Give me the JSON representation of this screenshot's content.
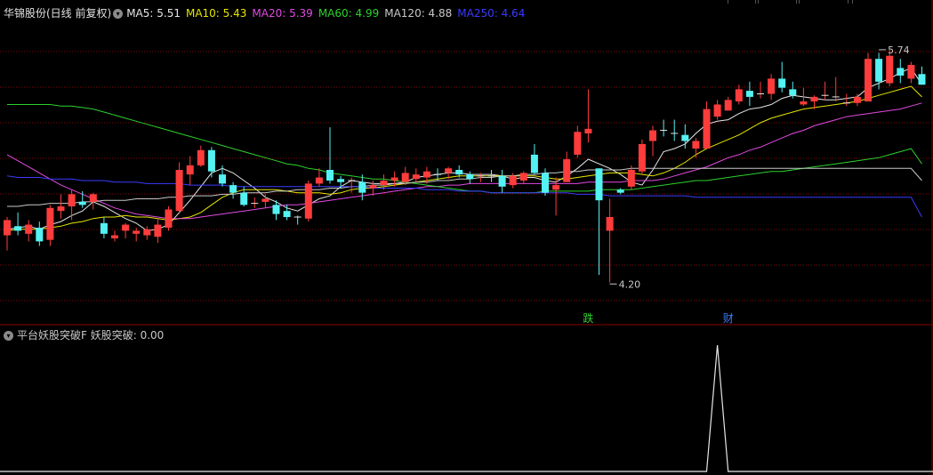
{
  "header": {
    "stock_label": "华锦股份(日线 前复权)",
    "ma": [
      {
        "label": "MA5: 5.51",
        "color": "#e6e6e6"
      },
      {
        "label": "MA10: 5.43",
        "color": "#e6e600"
      },
      {
        "label": "MA20: 5.39",
        "color": "#e24ae2"
      },
      {
        "label": "MA60: 4.99",
        "color": "#2dd12d"
      },
      {
        "label": "MA120: 4.88",
        "color": "#c8c8c8"
      },
      {
        "label": "MA250: 4.64",
        "color": "#3a3aff"
      }
    ]
  },
  "indicator": {
    "name": "平台妖股突破F",
    "value_label": "妖股突破: 0.00"
  },
  "colors": {
    "up": "#ff3c3c",
    "down": "#54f2f2",
    "grid": "#8b0000",
    "divider": "#8b0000"
  },
  "chart_data": [
    {
      "type": "candlestick",
      "title": "华锦股份(日线 前复权)",
      "ylim": [
        3.95,
        5.95
      ],
      "grid": true,
      "annotations": [
        {
          "text": "5.74",
          "candle": 81,
          "price": 5.74
        },
        {
          "text": "4.20",
          "candle": 56,
          "price": 4.2
        },
        {
          "text": "跌",
          "candle": 54,
          "color": "#2dd12d"
        },
        {
          "text": "财",
          "candle": 67,
          "color": "#3a7cff"
        }
      ],
      "candles": [
        [
          4.52,
          4.64,
          4.42,
          4.62
        ],
        [
          4.58,
          4.67,
          4.52,
          4.55
        ],
        [
          4.53,
          4.62,
          4.48,
          4.59
        ],
        [
          4.57,
          4.61,
          4.45,
          4.48
        ],
        [
          4.49,
          4.72,
          4.45,
          4.7
        ],
        [
          4.68,
          4.79,
          4.63,
          4.71
        ],
        [
          4.71,
          4.82,
          4.62,
          4.79
        ],
        [
          4.74,
          4.81,
          4.7,
          4.72
        ],
        [
          4.74,
          4.8,
          4.69,
          4.79
        ],
        [
          4.6,
          4.64,
          4.5,
          4.53
        ],
        [
          4.5,
          4.55,
          4.48,
          4.52
        ],
        [
          4.55,
          4.6,
          4.5,
          4.59
        ],
        [
          4.53,
          4.57,
          4.48,
          4.55
        ],
        [
          4.52,
          4.58,
          4.49,
          4.56
        ],
        [
          4.51,
          4.63,
          4.47,
          4.59
        ],
        [
          4.57,
          4.71,
          4.55,
          4.69
        ],
        [
          4.68,
          5.0,
          4.66,
          4.95
        ],
        [
          4.92,
          5.04,
          4.85,
          4.98
        ],
        [
          4.98,
          5.11,
          4.97,
          5.08
        ],
        [
          5.08,
          5.1,
          4.9,
          4.94
        ],
        [
          4.92,
          4.98,
          4.84,
          4.86
        ],
        [
          4.85,
          4.87,
          4.76,
          4.8
        ],
        [
          4.8,
          4.84,
          4.71,
          4.72
        ],
        [
          4.73,
          4.77,
          4.7,
          4.73
        ],
        [
          4.74,
          4.79,
          4.7,
          4.76
        ],
        [
          4.72,
          4.75,
          4.62,
          4.66
        ],
        [
          4.68,
          4.72,
          4.62,
          4.64
        ],
        [
          4.64,
          4.65,
          4.59,
          4.63
        ],
        [
          4.63,
          4.88,
          4.61,
          4.86
        ],
        [
          4.86,
          4.96,
          4.84,
          4.9
        ],
        [
          4.95,
          5.23,
          4.86,
          4.88
        ],
        [
          4.89,
          4.91,
          4.83,
          4.87
        ],
        [
          4.87,
          4.9,
          4.8,
          4.88
        ],
        [
          4.87,
          4.92,
          4.75,
          4.8
        ],
        [
          4.83,
          4.88,
          4.78,
          4.85
        ],
        [
          4.85,
          4.92,
          4.82,
          4.88
        ],
        [
          4.88,
          4.94,
          4.84,
          4.9
        ],
        [
          4.87,
          4.97,
          4.85,
          4.93
        ],
        [
          4.89,
          4.96,
          4.87,
          4.92
        ],
        [
          4.9,
          4.97,
          4.86,
          4.94
        ],
        [
          4.92,
          4.96,
          4.88,
          4.91
        ],
        [
          4.93,
          4.97,
          4.89,
          4.96
        ],
        [
          4.95,
          4.98,
          4.9,
          4.92
        ],
        [
          4.92,
          4.94,
          4.86,
          4.89
        ],
        [
          4.9,
          4.93,
          4.87,
          4.91
        ],
        [
          4.91,
          4.95,
          4.87,
          4.9
        ],
        [
          4.91,
          4.95,
          4.8,
          4.84
        ],
        [
          4.85,
          4.93,
          4.83,
          4.91
        ],
        [
          4.88,
          4.94,
          4.86,
          4.93
        ],
        [
          5.05,
          5.12,
          4.92,
          4.93
        ],
        [
          4.93,
          4.96,
          4.78,
          4.8
        ],
        [
          4.82,
          4.9,
          4.65,
          4.85
        ],
        [
          4.87,
          5.07,
          4.87,
          5.02
        ],
        [
          5.05,
          5.24,
          5.03,
          5.2
        ],
        [
          5.19,
          5.48,
          5.13,
          5.22
        ],
        [
          4.96,
          4.96,
          4.26,
          4.75
        ],
        [
          4.55,
          4.76,
          4.21,
          4.64
        ],
        [
          4.82,
          4.83,
          4.79,
          4.8
        ],
        [
          4.84,
          4.98,
          4.82,
          4.95
        ],
        [
          4.94,
          5.15,
          4.92,
          5.12
        ],
        [
          5.14,
          5.24,
          5.04,
          5.21
        ],
        [
          5.21,
          5.28,
          5.17,
          5.2
        ],
        [
          5.19,
          5.28,
          5.14,
          5.18
        ],
        [
          5.18,
          5.25,
          5.09,
          5.14
        ],
        [
          5.09,
          5.16,
          5.03,
          5.14
        ],
        [
          5.09,
          5.4,
          5.09,
          5.35
        ],
        [
          5.3,
          5.41,
          5.28,
          5.38
        ],
        [
          5.34,
          5.43,
          5.34,
          5.41
        ],
        [
          5.4,
          5.51,
          5.38,
          5.48
        ],
        [
          5.47,
          5.53,
          5.37,
          5.43
        ],
        [
          5.44,
          5.53,
          5.42,
          5.45
        ],
        [
          5.45,
          5.58,
          5.41,
          5.55
        ],
        [
          5.55,
          5.66,
          5.46,
          5.49
        ],
        [
          5.48,
          5.53,
          5.42,
          5.44
        ],
        [
          5.38,
          5.49,
          5.37,
          5.4
        ],
        [
          5.4,
          5.44,
          5.35,
          5.43
        ],
        [
          5.43,
          5.53,
          5.41,
          5.44
        ],
        [
          5.42,
          5.56,
          5.4,
          5.43
        ],
        [
          5.38,
          5.45,
          5.37,
          5.39
        ],
        [
          5.39,
          5.45,
          5.37,
          5.43
        ],
        [
          5.4,
          5.72,
          5.4,
          5.68
        ],
        [
          5.68,
          5.72,
          5.48,
          5.53
        ],
        [
          5.52,
          5.74,
          5.5,
          5.7
        ],
        [
          5.62,
          5.68,
          5.52,
          5.57
        ],
        [
          5.55,
          5.66,
          5.52,
          5.64
        ],
        [
          5.58,
          5.63,
          5.53,
          5.51
        ]
      ],
      "series": [
        {
          "name": "MA5",
          "color": "#e6e6e6",
          "values": [
            4.56,
            4.57,
            4.58,
            4.56,
            4.59,
            4.61,
            4.65,
            4.68,
            4.74,
            4.71,
            4.67,
            4.63,
            4.6,
            4.55,
            4.56,
            4.59,
            4.67,
            4.75,
            4.84,
            4.93,
            4.96,
            4.93,
            4.88,
            4.83,
            4.77,
            4.74,
            4.7,
            4.68,
            4.72,
            4.76,
            4.78,
            4.84,
            4.88,
            4.87,
            4.86,
            4.86,
            4.86,
            4.87,
            4.9,
            4.91,
            4.92,
            4.93,
            4.93,
            4.92,
            4.92,
            4.92,
            4.91,
            4.89,
            4.9,
            4.9,
            4.88,
            4.87,
            4.91,
            4.96,
            5.02,
            4.99,
            4.96,
            4.92,
            4.87,
            4.85,
            4.95,
            5.07,
            5.09,
            5.12,
            5.19,
            5.25,
            5.27,
            5.28,
            5.32,
            5.35,
            5.36,
            5.38,
            5.42,
            5.44,
            5.43,
            5.42,
            5.41,
            5.41,
            5.42,
            5.43,
            5.49,
            5.52,
            5.55,
            5.59,
            5.62,
            5.51
          ]
        },
        {
          "name": "MA10",
          "color": "#e6e600",
          "values": [
            4.55,
            4.56,
            4.56,
            4.56,
            4.57,
            4.58,
            4.6,
            4.61,
            4.63,
            4.64,
            4.64,
            4.65,
            4.64,
            4.64,
            4.63,
            4.62,
            4.63,
            4.64,
            4.67,
            4.72,
            4.77,
            4.8,
            4.82,
            4.82,
            4.82,
            4.82,
            4.81,
            4.8,
            4.8,
            4.8,
            4.79,
            4.8,
            4.82,
            4.83,
            4.83,
            4.84,
            4.85,
            4.86,
            4.87,
            4.88,
            4.89,
            4.9,
            4.91,
            4.91,
            4.91,
            4.91,
            4.91,
            4.91,
            4.91,
            4.91,
            4.9,
            4.89,
            4.89,
            4.9,
            4.91,
            4.92,
            4.93,
            4.93,
            4.93,
            4.92,
            4.91,
            4.93,
            4.96,
            5.0,
            5.05,
            5.09,
            5.12,
            5.15,
            5.18,
            5.22,
            5.26,
            5.29,
            5.31,
            5.33,
            5.35,
            5.36,
            5.37,
            5.38,
            5.39,
            5.4,
            5.42,
            5.44,
            5.46,
            5.48,
            5.5,
            5.43
          ]
        },
        {
          "name": "MA20",
          "color": "#e24ae2",
          "values": [
            5.05,
            5.01,
            4.97,
            4.93,
            4.89,
            4.85,
            4.82,
            4.79,
            4.76,
            4.73,
            4.7,
            4.68,
            4.66,
            4.65,
            4.64,
            4.63,
            4.63,
            4.63,
            4.64,
            4.65,
            4.66,
            4.67,
            4.68,
            4.69,
            4.7,
            4.71,
            4.72,
            4.72,
            4.73,
            4.74,
            4.75,
            4.76,
            4.77,
            4.78,
            4.79,
            4.8,
            4.81,
            4.82,
            4.83,
            4.84,
            4.84,
            4.85,
            4.85,
            4.86,
            4.86,
            4.86,
            4.86,
            4.86,
            4.86,
            4.86,
            4.86,
            4.86,
            4.86,
            4.86,
            4.87,
            4.87,
            4.87,
            4.87,
            4.88,
            4.88,
            4.88,
            4.89,
            4.91,
            4.93,
            4.95,
            4.97,
            5.0,
            5.03,
            5.05,
            5.08,
            5.1,
            5.13,
            5.16,
            5.19,
            5.21,
            5.24,
            5.26,
            5.28,
            5.3,
            5.31,
            5.32,
            5.33,
            5.34,
            5.35,
            5.37,
            5.39
          ]
        },
        {
          "name": "MA60",
          "color": "#2dd12d",
          "values": [
            5.38,
            5.38,
            5.38,
            5.38,
            5.38,
            5.37,
            5.37,
            5.36,
            5.35,
            5.33,
            5.31,
            5.29,
            5.27,
            5.25,
            5.23,
            5.21,
            5.19,
            5.17,
            5.15,
            5.13,
            5.11,
            5.09,
            5.07,
            5.05,
            5.03,
            5.01,
            4.99,
            4.98,
            4.96,
            4.95,
            4.93,
            4.92,
            4.91,
            4.9,
            4.89,
            4.89,
            4.88,
            4.87,
            4.86,
            4.85,
            4.84,
            4.83,
            4.82,
            4.81,
            4.81,
            4.8,
            4.8,
            4.8,
            4.8,
            4.8,
            4.81,
            4.81,
            4.81,
            4.81,
            4.81,
            4.82,
            4.82,
            4.82,
            4.82,
            4.83,
            4.84,
            4.85,
            4.86,
            4.87,
            4.88,
            4.88,
            4.89,
            4.9,
            4.91,
            4.92,
            4.93,
            4.94,
            4.94,
            4.95,
            4.96,
            4.97,
            4.98,
            4.99,
            5.0,
            5.01,
            5.02,
            5.03,
            5.05,
            5.07,
            5.09,
            4.99
          ]
        },
        {
          "name": "MA120",
          "color": "#c8c8c8",
          "values": [
            4.71,
            4.71,
            4.72,
            4.72,
            4.73,
            4.73,
            4.73,
            4.74,
            4.74,
            4.75,
            4.75,
            4.75,
            4.76,
            4.76,
            4.76,
            4.77,
            4.77,
            4.78,
            4.78,
            4.78,
            4.79,
            4.79,
            4.8,
            4.8,
            4.8,
            4.81,
            4.81,
            4.82,
            4.82,
            4.82,
            4.83,
            4.83,
            4.84,
            4.84,
            4.85,
            4.85,
            4.86,
            4.86,
            4.87,
            4.87,
            4.88,
            4.88,
            4.89,
            4.89,
            4.9,
            4.9,
            4.91,
            4.91,
            4.92,
            4.92,
            4.93,
            4.93,
            4.94,
            4.94,
            4.95,
            4.95,
            4.95,
            4.95,
            4.96,
            4.96,
            4.96,
            4.96,
            4.96,
            4.96,
            4.96,
            4.96,
            4.96,
            4.96,
            4.96,
            4.96,
            4.96,
            4.96,
            4.96,
            4.96,
            4.96,
            4.96,
            4.96,
            4.96,
            4.96,
            4.96,
            4.96,
            4.96,
            4.96,
            4.96,
            4.96,
            4.88
          ]
        },
        {
          "name": "MA250",
          "color": "#3a3aff",
          "values": [
            4.91,
            4.9,
            4.9,
            4.9,
            4.89,
            4.89,
            4.89,
            4.88,
            4.88,
            4.88,
            4.87,
            4.87,
            4.87,
            4.86,
            4.86,
            4.86,
            4.86,
            4.85,
            4.85,
            4.85,
            4.85,
            4.84,
            4.84,
            4.84,
            4.84,
            4.84,
            4.84,
            4.84,
            4.84,
            4.84,
            4.84,
            4.84,
            4.84,
            4.84,
            4.83,
            4.83,
            4.83,
            4.83,
            4.83,
            4.82,
            4.82,
            4.82,
            4.81,
            4.81,
            4.81,
            4.8,
            4.8,
            4.8,
            4.8,
            4.8,
            4.8,
            4.8,
            4.8,
            4.79,
            4.79,
            4.79,
            4.78,
            4.78,
            4.78,
            4.78,
            4.78,
            4.78,
            4.78,
            4.78,
            4.77,
            4.77,
            4.77,
            4.77,
            4.77,
            4.77,
            4.77,
            4.77,
            4.77,
            4.77,
            4.77,
            4.77,
            4.77,
            4.77,
            4.77,
            4.77,
            4.77,
            4.77,
            4.77,
            4.77,
            4.77,
            4.64
          ]
        }
      ]
    },
    {
      "type": "line",
      "title": "平台妖股突破F",
      "series": [
        {
          "name": "妖股突破",
          "color": "#e6e6e6",
          "values": [
            0,
            0,
            0,
            0,
            0,
            0,
            0,
            0,
            0,
            0,
            0,
            0,
            0,
            0,
            0,
            0,
            0,
            0,
            0,
            0,
            0,
            0,
            0,
            0,
            0,
            0,
            0,
            0,
            0,
            0,
            0,
            0,
            0,
            0,
            0,
            0,
            0,
            0,
            0,
            0,
            0,
            0,
            0,
            0,
            0,
            0,
            0,
            0,
            0,
            0,
            0,
            0,
            0,
            0,
            0,
            0,
            0,
            0,
            0,
            0,
            0,
            0,
            0,
            0,
            0,
            0,
            1,
            0,
            0,
            0,
            0,
            0,
            0,
            0,
            0,
            0,
            0,
            0,
            0,
            0,
            0,
            0,
            0,
            0,
            0,
            0
          ]
        }
      ],
      "ylim": [
        0,
        1
      ]
    }
  ]
}
